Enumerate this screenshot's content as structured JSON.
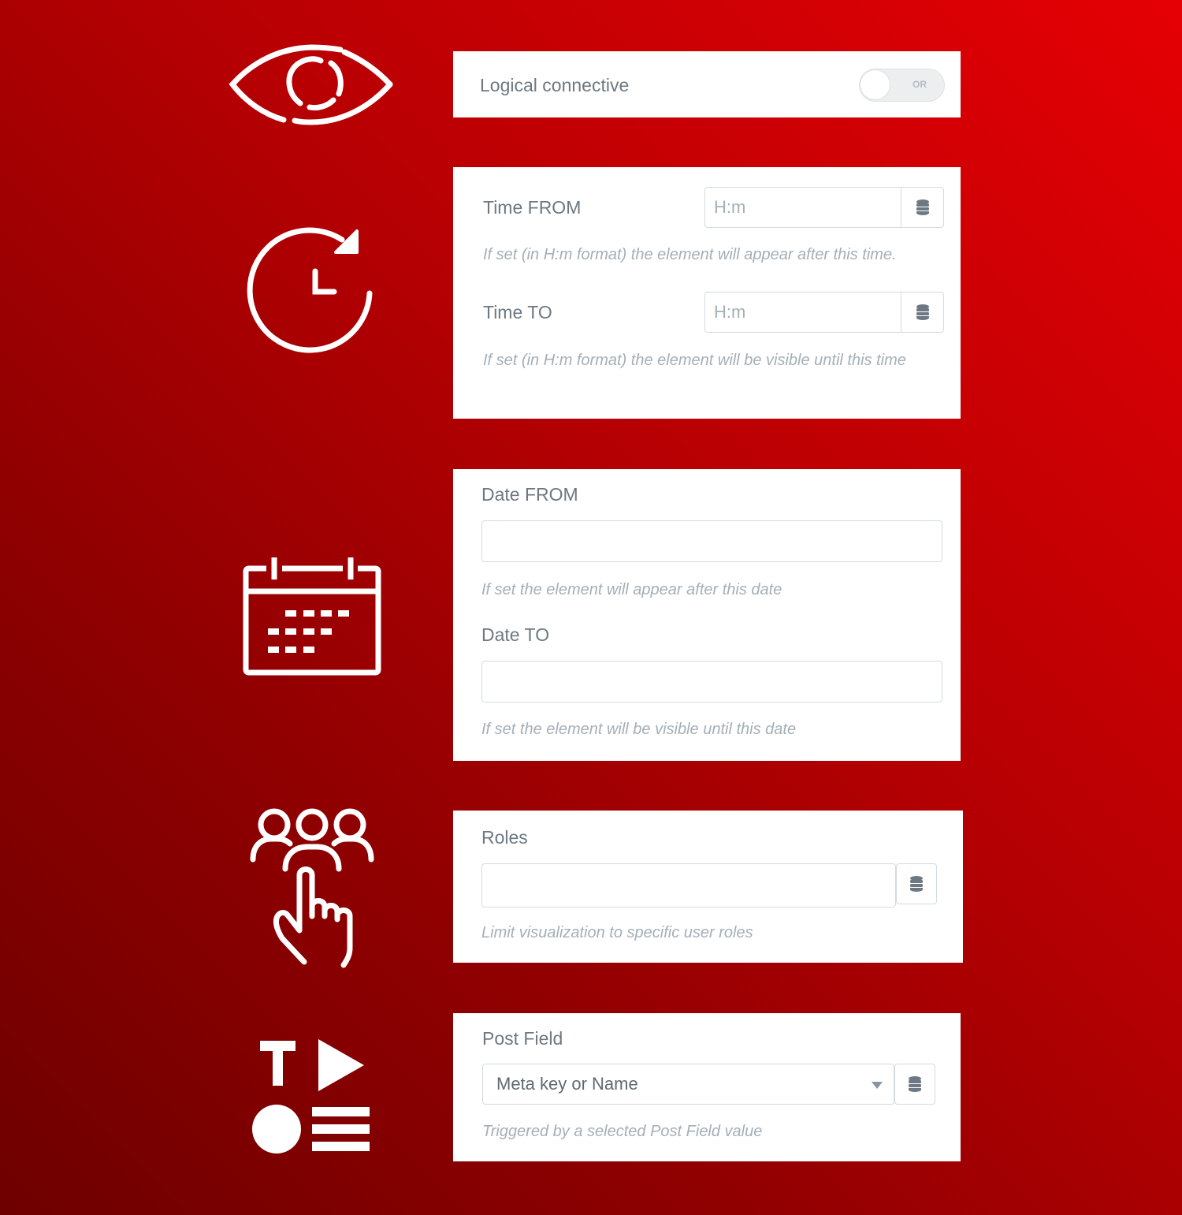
{
  "colors": {
    "background_light": "#e50004",
    "background_dark": "#6e0000",
    "label_text": "#6d7882",
    "hint_text": "#a4afb7",
    "input_border": "#d5dadf",
    "icon_color": "#ffffff"
  },
  "icons": {
    "visibility": "eye-icon",
    "time": "clock-refresh-icon",
    "date": "calendar-icon",
    "roles": "users-pointer-icon",
    "post_field": "content-types-icon"
  },
  "logical_connective": {
    "label": "Logical connective",
    "toggle_text": "OR",
    "toggle_on": false
  },
  "time": {
    "from": {
      "label": "Time FROM",
      "placeholder": "H:m",
      "value": "",
      "hint": "If set (in H:m format) the element will appear after this time."
    },
    "to": {
      "label": "Time TO",
      "placeholder": "H:m",
      "value": "",
      "hint": "If set (in H:m format) the element will be visible until this time"
    },
    "dynamic_button_icon": "database-icon"
  },
  "date": {
    "from": {
      "label": "Date FROM",
      "value": "",
      "hint": "If set the element will appear after this date"
    },
    "to": {
      "label": "Date TO",
      "value": "",
      "hint": "If set the element will be visible until this date"
    }
  },
  "roles": {
    "label": "Roles",
    "value": "",
    "hint": "Limit visualization to specific user roles",
    "dynamic_button_icon": "database-icon"
  },
  "post_field": {
    "label": "Post Field",
    "selected": "Meta key or Name",
    "hint": "Triggered by a selected Post Field value",
    "dynamic_button_icon": "database-icon"
  }
}
